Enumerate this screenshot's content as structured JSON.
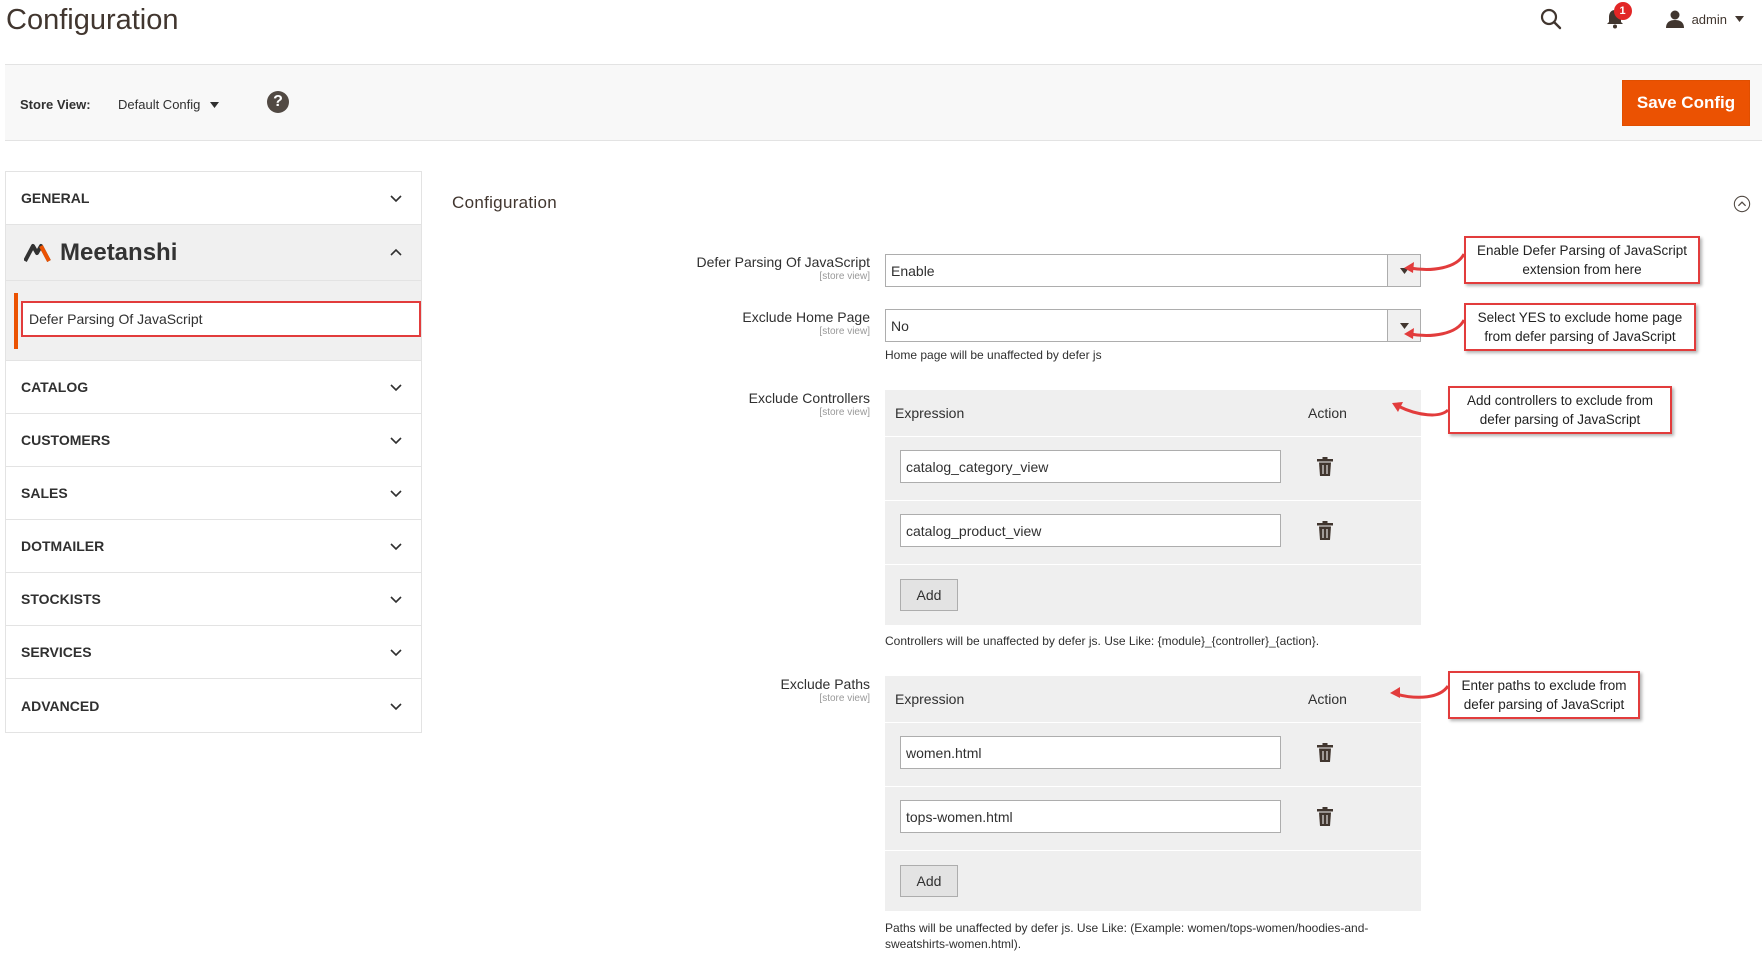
{
  "header": {
    "title": "Configuration",
    "notifications_count": "1",
    "user": "admin"
  },
  "store_bar": {
    "label": "Store View:",
    "selected": "Default Config",
    "help": "?",
    "save_label": "Save Config"
  },
  "sidebar": {
    "general": "GENERAL",
    "brand": "Meetanshi",
    "sub_item": "Defer Parsing Of JavaScript",
    "items": [
      "CATALOG",
      "CUSTOMERS",
      "SALES",
      "DOTMAILER",
      "STOCKISTS",
      "SERVICES",
      "ADVANCED"
    ]
  },
  "main": {
    "section_title": "Configuration",
    "fields": {
      "defer": {
        "label": "Defer Parsing Of JavaScript",
        "scope": "[store view]",
        "value": "Enable"
      },
      "home": {
        "label": "Exclude Home Page",
        "scope": "[store view]",
        "value": "No",
        "note": "Home page will be unaffected by defer js"
      },
      "controllers": {
        "label": "Exclude Controllers",
        "scope": "[store view]",
        "col_expression": "Expression",
        "col_action": "Action",
        "rows": [
          "catalog_category_view",
          "catalog_product_view"
        ],
        "add": "Add",
        "note": "Controllers will be unaffected by defer js. Use Like: {module}_{controller}_{action}."
      },
      "paths": {
        "label": "Exclude Paths",
        "scope": "[store view]",
        "col_expression": "Expression",
        "col_action": "Action",
        "rows": [
          "women.html",
          "tops-women.html"
        ],
        "add": "Add",
        "note_line1": "Paths will be unaffected by defer js. Use Like: (Example: women/tops-women/hoodies-and-",
        "note_line2": "sweatshirts-women.html)."
      }
    }
  },
  "callouts": {
    "c1_line1": "Enable Defer Parsing of JavaScript",
    "c1_line2": "extension from here",
    "c2_line1": "Select YES to exclude home page",
    "c2_line2": "from defer parsing of JavaScript",
    "c3_line1": "Add controllers to exclude from",
    "c3_line2": "defer parsing of JavaScript",
    "c4_line1": "Enter paths to exclude from",
    "c4_line2": "defer parsing of JavaScript"
  },
  "colors": {
    "accent": "#eb5202",
    "callout_border": "#e23c3c",
    "badge": "#e22626"
  }
}
